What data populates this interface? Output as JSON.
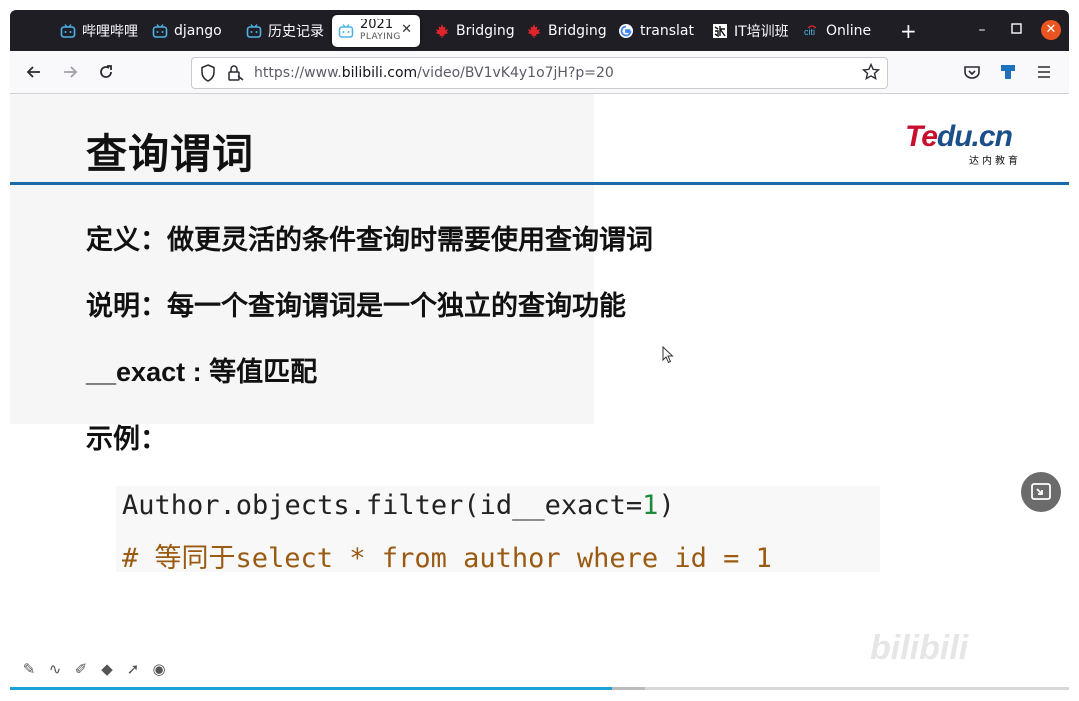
{
  "browser": {
    "tabs": [
      {
        "title": "哔哩哔哩",
        "icon": "bilibili-icon"
      },
      {
        "title": "django",
        "icon": "bilibili-icon"
      },
      {
        "title": "历史记录",
        "icon": "bilibili-icon"
      },
      {
        "title": "2021",
        "subtitle": "PLAYING",
        "icon": "bilibili-icon",
        "active": true
      },
      {
        "title": "Bridging",
        "icon": "maple-leaf-icon"
      },
      {
        "title": "Bridging",
        "icon": "maple-leaf-icon"
      },
      {
        "title": "translat",
        "icon": "google-icon"
      },
      {
        "title": "IT培训班",
        "icon": "da-logo-icon"
      },
      {
        "title": "Online",
        "icon": "citi-icon"
      }
    ],
    "new_tab_label": "+",
    "url_prefix": "https://www.",
    "url_host": "bilibili.com",
    "url_path": "/video/BV1vK4y1o7jH?p=20"
  },
  "slide": {
    "title": "查询谓词",
    "logo_text_1": "Te",
    "logo_text_2": "du.cn",
    "logo_sub": "达内教育",
    "line1": "定义：做更灵活的条件查询时需要使用查询谓词",
    "line2": "说明：每一个查询谓词是一个独立的查询功能",
    "line3": "__exact : 等值匹配",
    "line4": "示例：",
    "code_line1_pre": "Author.objects.filter(id__exact=",
    "code_line1_num": "1",
    "code_line1_post": ")",
    "code_line2": "# 等同于select * from author where id = 1"
  },
  "player": {
    "watermark": "bilibili",
    "progress_fraction": 0.568,
    "buffered_fraction": 0.6
  },
  "colors": {
    "tab_strip": "#1f1e25",
    "title_rule": "#1d6aa8",
    "code_keyword_num": "#1f8a3a",
    "code_comment": "#9a5a12",
    "progress": "#1aa3d6",
    "close_button": "#e95420"
  }
}
